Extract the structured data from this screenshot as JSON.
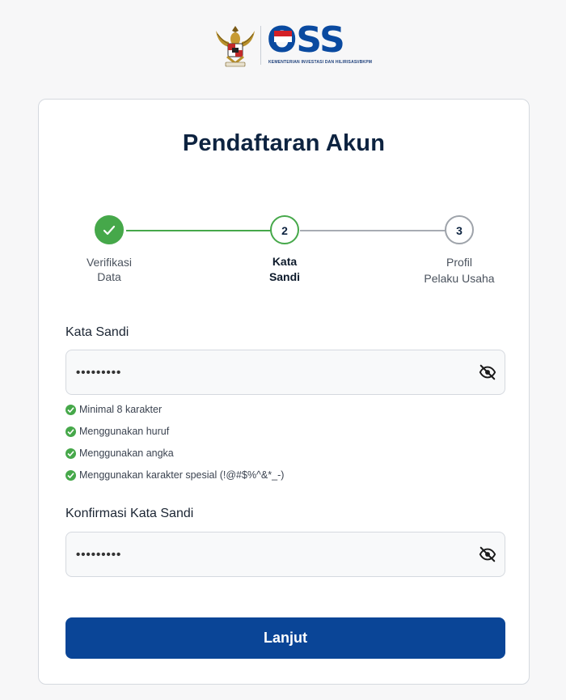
{
  "header": {
    "logo_text": "OSS",
    "logo_subtitle": "KEMENTERIAN INVESTASI DAN HILIRISASI/BKPM"
  },
  "page": {
    "title": "Pendaftaran Akun"
  },
  "stepper": {
    "steps": [
      {
        "number": "1",
        "label_line1": "Verifikasi",
        "label_line2": "Data",
        "status": "completed"
      },
      {
        "number": "2",
        "label_line1": "Kata",
        "label_line2": "Sandi",
        "status": "active"
      },
      {
        "number": "3",
        "label_line1": "Profil",
        "label_line2": "Pelaku Usaha",
        "status": "pending"
      }
    ]
  },
  "form": {
    "password": {
      "label": "Kata Sandi",
      "value": "•••••••••"
    },
    "requirements": [
      "Minimal 8 karakter",
      "Menggunakan huruf",
      "Menggunakan angka",
      "Menggunakan karakter spesial (!@#$%^&*_-)"
    ],
    "confirm": {
      "label": "Konfirmasi Kata Sandi",
      "value": "•••••••••"
    },
    "submit_label": "Lanjut"
  },
  "colors": {
    "accent": "#0a4597",
    "success": "#46a84a",
    "title": "#0d2340"
  },
  "icons": {
    "step_done": "check-icon",
    "visibility": "eye-off-icon",
    "requirement": "check-circle-icon"
  }
}
